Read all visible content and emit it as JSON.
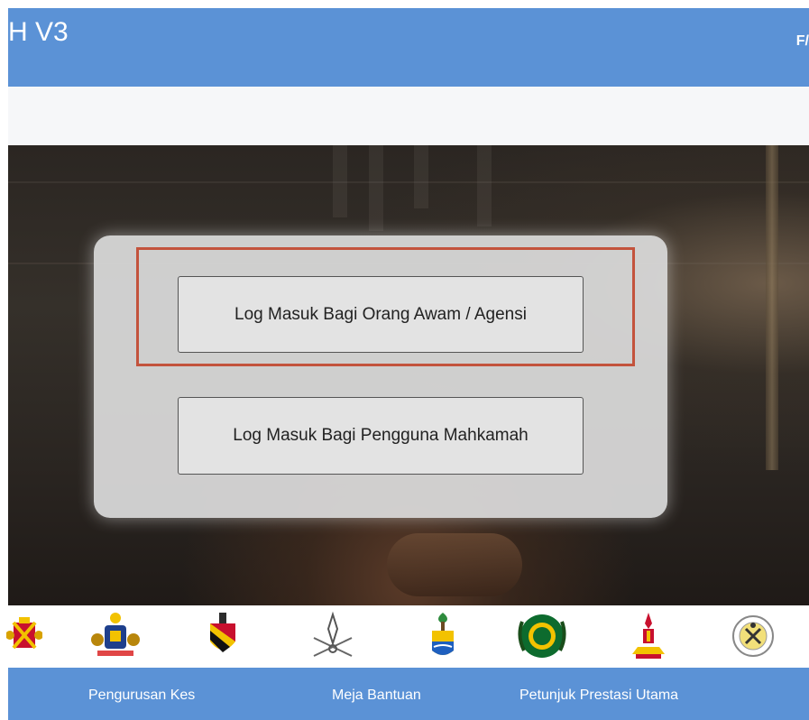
{
  "header": {
    "title": "H V3",
    "right_text": "F/"
  },
  "login": {
    "public_button_label": "Log Masuk Bagi Orang Awam / Agensi",
    "court_button_label": "Log Masuk Bagi Pengguna Mahkamah"
  },
  "state_logos": [
    {
      "icon": "state-crest-icon-1"
    },
    {
      "icon": "state-crest-icon-2"
    },
    {
      "icon": "state-crest-icon-3"
    },
    {
      "icon": "state-crest-icon-4"
    },
    {
      "icon": "state-crest-icon-5"
    },
    {
      "icon": "state-crest-icon-6"
    },
    {
      "icon": "state-crest-icon-7"
    },
    {
      "icon": "state-crest-icon-8"
    }
  ],
  "footer_nav": {
    "items": [
      {
        "label": "Pengurusan Kes"
      },
      {
        "label": "Meja Bantuan"
      },
      {
        "label": "Petunjuk Prestasi Utama"
      }
    ]
  },
  "colors": {
    "header_bg": "#5b92d6",
    "highlight": "#c3533c"
  }
}
